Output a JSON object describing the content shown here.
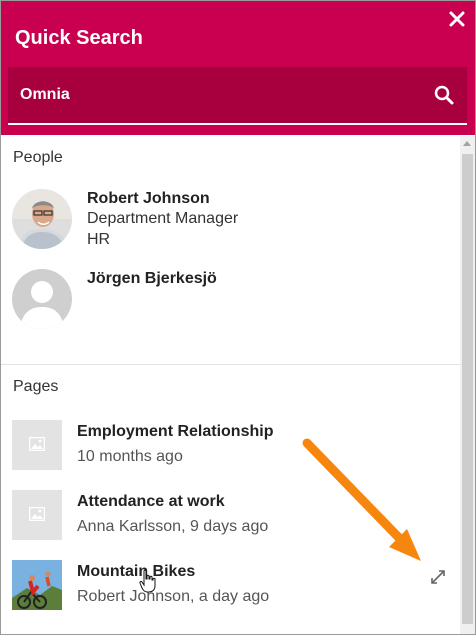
{
  "header": {
    "title": "Quick Search",
    "close_icon": "close-icon",
    "color": "#c8004f"
  },
  "search": {
    "value": "Omnia",
    "icon": "search-icon"
  },
  "people": {
    "label": "People",
    "items": [
      {
        "name": "Robert Johnson",
        "title": "Department Manager",
        "department": "HR",
        "avatar": "photo"
      },
      {
        "name": "Jörgen Bjerkesjö",
        "avatar": "placeholder-avatar-icon"
      }
    ]
  },
  "pages": {
    "label": "Pages",
    "items": [
      {
        "title": "Employment Relationship",
        "meta": "10 months ago",
        "thumbnail": "image-placeholder-icon"
      },
      {
        "title": "Attendance at work",
        "meta": "Anna Karlsson, 9 days ago",
        "thumbnail": "image-placeholder-icon"
      },
      {
        "title": "Mountain Bikes",
        "meta": "Robert Johnson, a day ago",
        "thumbnail": "photo"
      }
    ]
  },
  "annotation": {
    "arrow_color": "#f7860f",
    "expand_icon": "expand-icon"
  }
}
